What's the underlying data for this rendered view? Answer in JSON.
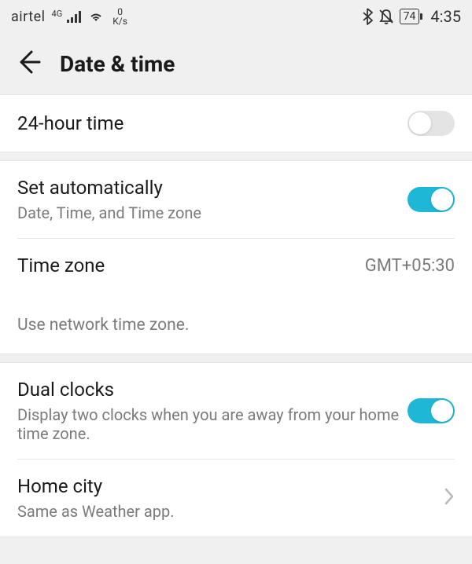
{
  "statusbar": {
    "carrier": "airtel",
    "network_tag": "4G",
    "speed_value": "0",
    "speed_unit": "K/s",
    "battery_pct": "74",
    "time": "4:35"
  },
  "header": {
    "title": "Date & time"
  },
  "option_24h": {
    "label": "24-hour time",
    "enabled": false
  },
  "option_auto": {
    "label": "Set automatically",
    "sub": "Date, Time, and Time zone",
    "enabled": true
  },
  "timezone": {
    "label": "Time zone",
    "value": "GMT+05:30",
    "note": "Use network time zone."
  },
  "dual_clocks": {
    "label": "Dual clocks",
    "sub": "Display two clocks when you are away from your home time zone.",
    "enabled": true
  },
  "home_city": {
    "label": "Home city",
    "sub": "Same as Weather app."
  }
}
